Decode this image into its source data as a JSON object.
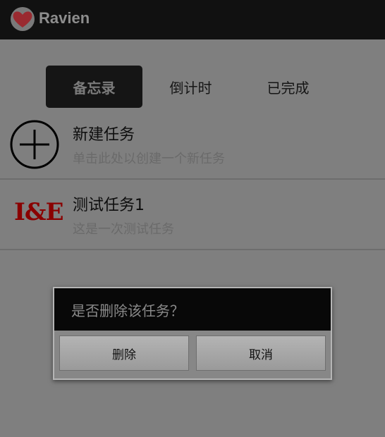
{
  "app": {
    "title": "Ravien",
    "logo_icon": "heart-icon",
    "logo_color": "#d1363e"
  },
  "tabs": [
    {
      "label": "备忘录",
      "active": true
    },
    {
      "label": "倒计时",
      "active": false
    },
    {
      "label": "已完成",
      "active": false
    }
  ],
  "tasks": [
    {
      "icon": "add-circle-icon",
      "title": "新建任务",
      "subtitle": "单击此处以创建一个新任务"
    },
    {
      "icon": "ie-logo",
      "icon_text": "I&E",
      "title": "测试任务1",
      "subtitle": "这是一次测试任务"
    }
  ],
  "dialog": {
    "title": "是否删除该任务？",
    "delete_label": "删除",
    "cancel_label": "取消"
  }
}
